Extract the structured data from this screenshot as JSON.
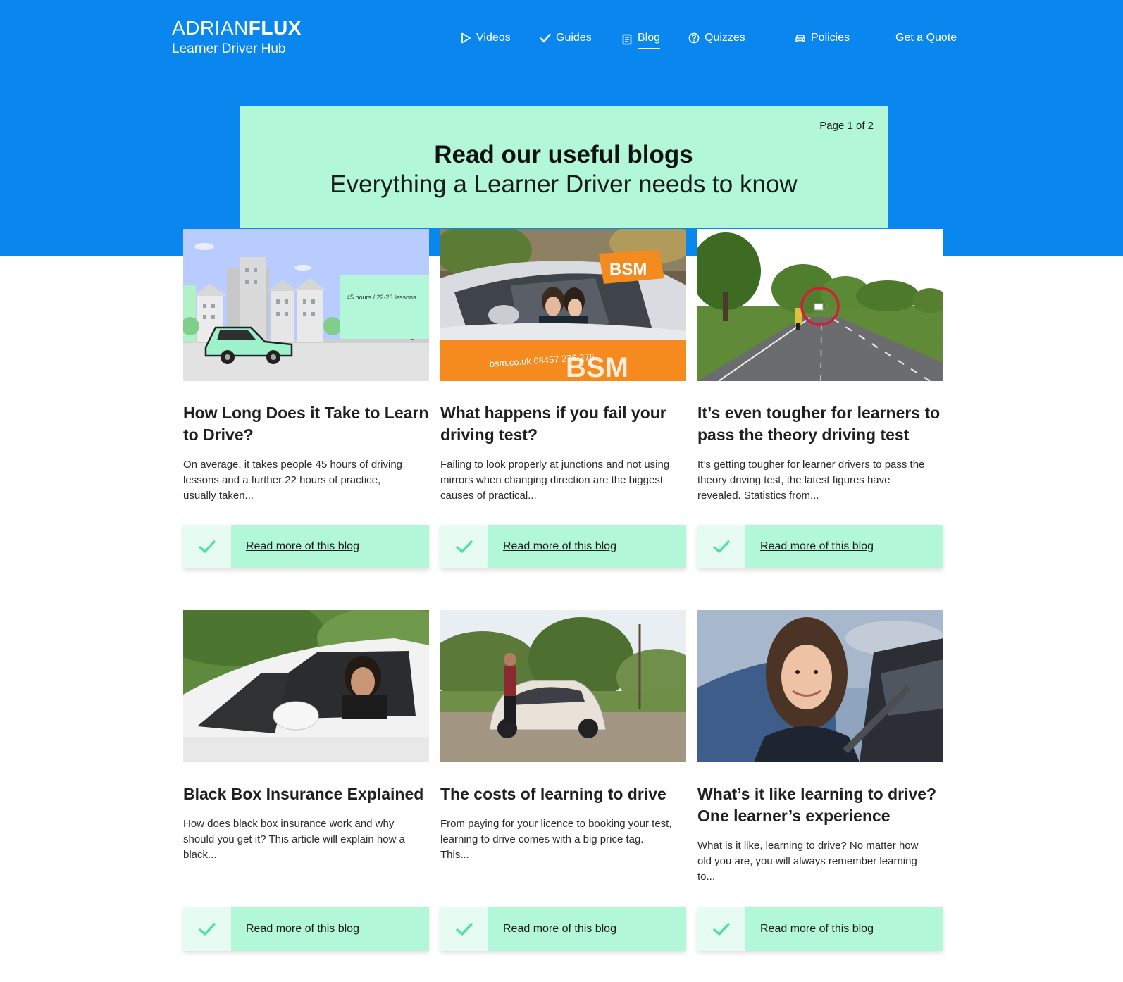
{
  "header": {
    "brand_thin": "ADRIAN",
    "brand_bold": "FLUX",
    "subtitle": "Learner Driver Hub"
  },
  "nav": [
    {
      "label": "Videos",
      "icon": "play-icon"
    },
    {
      "label": "Guides",
      "icon": "check-icon"
    },
    {
      "label": "Blog",
      "icon": "book-icon",
      "active": true
    },
    {
      "label": "Quizzes",
      "icon": "question-icon"
    },
    {
      "label": "Policies",
      "icon": "car-icon"
    },
    {
      "label": "Get a Quote"
    }
  ],
  "banner": {
    "page_indicator": "Page 1 of 2",
    "heading": "Read our useful blogs",
    "subheading": "Everything a Learner Driver needs to know"
  },
  "posts": [
    {
      "image_text": "45 hours / 22-23 lessons",
      "title": "How Long Does it Take to Learn to Drive?",
      "excerpt": "On average, it takes people 45 hours of driving lessons and a further 22 hours of practice, usually taken...",
      "cta": "Read more of this blog"
    },
    {
      "image_text": "bsm.co.uk 08457 276 276",
      "image_logo": "BSM",
      "title": "What happens if you fail your driving test?",
      "excerpt": "Failing to look properly at junctions and not using mirrors when changing direction are the biggest causes of practical...",
      "cta": "Read more of this blog"
    },
    {
      "title": "It’s even tougher for learners to pass the theory driving test",
      "excerpt": "It’s getting tougher for learner drivers to pass the theory driving test, the latest figures have revealed. Statistics from...",
      "cta": "Read more of this blog"
    },
    {
      "title": "Black Box Insurance Explained",
      "excerpt": "How does black box insurance work and why should you get it? This article will explain how a black...",
      "cta": "Read more of this blog"
    },
    {
      "title": "The costs of learning to drive",
      "excerpt": "From paying for your licence to booking your test, learning to drive comes with a big price tag. This...",
      "cta": "Read more of this blog"
    },
    {
      "title": "What’s it like learning to drive? One learner’s experience",
      "excerpt": "What is it like, learning to drive? No matter how old you are, you will always remember learning to...",
      "cta": "Read more of this blog"
    }
  ],
  "colors": {
    "primary_blue": "#0a87ee",
    "mint": "#b2f7d7",
    "mint_light": "#e6fcf2",
    "tick_green": "#4fe0a4"
  }
}
